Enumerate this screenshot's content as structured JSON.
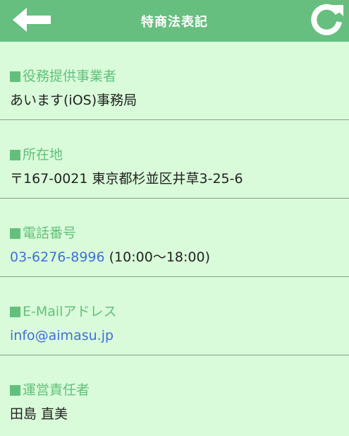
{
  "header": {
    "title": "特商法表記",
    "back_icon": "arrow-left-icon",
    "refresh_icon": "refresh-icon"
  },
  "sections": [
    {
      "label": "役務提供事業者",
      "value": "あいます(iOS)事務局"
    },
    {
      "label": "所在地",
      "value": "〒167-0021 東京都杉並区井草3-25-6"
    },
    {
      "label": "電話番号",
      "phone": "03-6276-8996",
      "hours": " (10:00〜18:00)"
    },
    {
      "label": "E-Mailアドレス",
      "email": "info@aimasu.jp"
    },
    {
      "label": "運営責任者",
      "value": "田島 直美"
    }
  ],
  "colors": {
    "header_bg": "#66bf7f",
    "page_bg": "#d9fbd9",
    "label": "#62c07c",
    "link": "#3f6fd9"
  }
}
